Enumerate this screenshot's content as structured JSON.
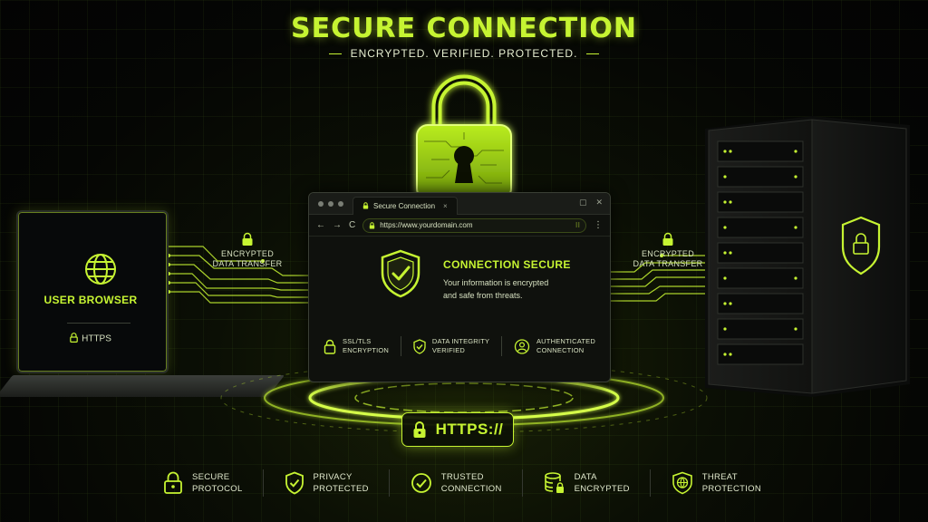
{
  "header": {
    "title": "SECURE CONNECTION",
    "subtitle": "ENCRYPTED. VERIFIED. PROTECTED."
  },
  "laptop": {
    "label": "USER BROWSER",
    "protocol": "HTTPS"
  },
  "transfers": {
    "left": {
      "line1": "ENCRYPTED",
      "line2": "DATA TRANSFER"
    },
    "right": {
      "line1": "ENCRYPTED",
      "line2": "DATA TRANSFER"
    }
  },
  "browser": {
    "tab_title": "Secure Connection",
    "tab_close": "×",
    "url": "https://www.yourdomain.com",
    "url_extras": "⁝⁝",
    "nav": {
      "back": "←",
      "forward": "→",
      "reload": "C",
      "menu": "⋮"
    },
    "window_controls": {
      "minimize": "▢",
      "close": "✕"
    },
    "status_title": "CONNECTION SECURE",
    "status_desc_line1": "Your information is encrypted",
    "status_desc_line2": "and safe from threats.",
    "features": [
      {
        "icon": "lock-icon",
        "line1": "SSL/TLS",
        "line2": "ENCRYPTION"
      },
      {
        "icon": "shield-check-icon",
        "line1": "DATA INTEGRITY",
        "line2": "VERIFIED"
      },
      {
        "icon": "user-check-icon",
        "line1": "AUTHENTICATED",
        "line2": "CONNECTION"
      }
    ]
  },
  "badge": {
    "text": "HTTPS://"
  },
  "bottom_features": [
    {
      "icon": "lock-icon",
      "line1": "SECURE",
      "line2": "PROTOCOL"
    },
    {
      "icon": "shield-check-icon",
      "line1": "PRIVACY",
      "line2": "PROTECTED"
    },
    {
      "icon": "check-circle-icon",
      "line1": "TRUSTED",
      "line2": "CONNECTION"
    },
    {
      "icon": "database-lock-icon",
      "line1": "DATA",
      "line2": "ENCRYPTED"
    },
    {
      "icon": "globe-shield-icon",
      "line1": "THREAT",
      "line2": "PROTECTION"
    }
  ],
  "colors": {
    "accent": "#c6f432",
    "background": "#050604",
    "panel": "#0f110d"
  }
}
